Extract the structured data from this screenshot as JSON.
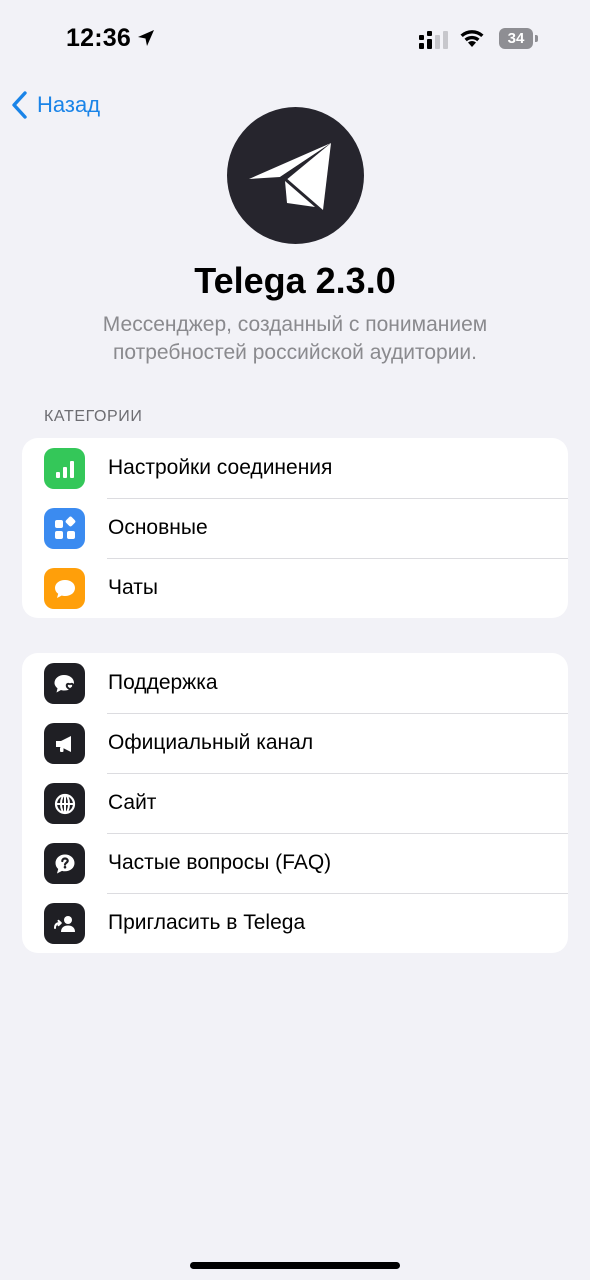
{
  "status_bar": {
    "time": "12:36",
    "battery": "34"
  },
  "nav": {
    "back_label": "Назад"
  },
  "app": {
    "title": "Telega 2.3.0",
    "description": "Мессенджер, созданный с пониманием потребностей российской аудитории."
  },
  "categories": {
    "header": "КАТЕГОРИИ",
    "items": [
      {
        "label": "Настройки соединения",
        "icon": "signal-bars-icon",
        "color": "#34c759"
      },
      {
        "label": "Основные",
        "icon": "apps-grid-icon",
        "color": "#3b8bf0"
      },
      {
        "label": "Чаты",
        "icon": "chat-bubble-icon",
        "color": "#ff9f0a"
      }
    ]
  },
  "links": {
    "items": [
      {
        "label": "Поддержка",
        "icon": "support-heart-bubble-icon",
        "color": "#1f1f24"
      },
      {
        "label": "Официальный канал",
        "icon": "megaphone-icon",
        "color": "#1f1f24"
      },
      {
        "label": "Сайт",
        "icon": "globe-icon",
        "color": "#1f1f24"
      },
      {
        "label": "Частые вопросы (FAQ)",
        "icon": "question-bubble-icon",
        "color": "#1f1f24"
      },
      {
        "label": "Пригласить в Telega",
        "icon": "invite-person-icon",
        "color": "#1f1f24"
      }
    ]
  },
  "colors": {
    "accent": "#1a84e8",
    "background": "#f2f2f7",
    "logo_bg": "#26252d"
  }
}
